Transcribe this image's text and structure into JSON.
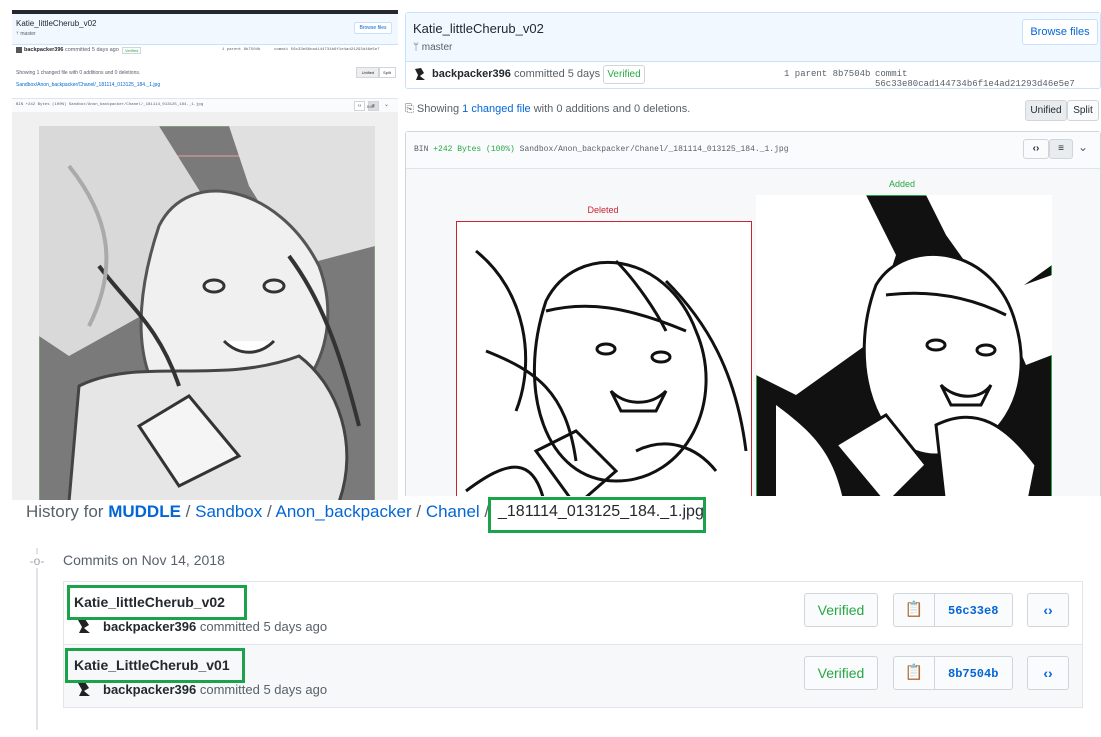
{
  "left_shot": {
    "title": "Katie_littleCherub_v02",
    "branch": "master",
    "browse_label": "Browse files",
    "author": "backpacker396",
    "committed_text": "committed 5 days ago",
    "verified_label": "Verified",
    "parent_text": "1 parent 8b7504b",
    "commit_text": "commit 56c33e88cad144734b6f1e4ad21293d46e5e7",
    "showing_text": "Showing 1 changed file with 0 additions and 0 deletions.",
    "unified_label": "Unified",
    "split_label": "Split",
    "path_text": "Sandbox/Anon_backpacker/Chanel/_181114_013125_184._1.jpg",
    "diff_header": "BIN +242 Bytes (100%) Sandbox/Anon_backpacker/Chanel/_181114_013125_184._1.jpg",
    "bin_label": "BIN"
  },
  "right_shot": {
    "title": "Katie_littleCherub_v02",
    "branch": "master",
    "browse_label": "Browse files",
    "author": "backpacker396",
    "committed_text": "committed 5 days ago",
    "verified_label": "Verified",
    "parent_text": "1 parent 8b7504b",
    "commit_text": "commit 56c33e80cad144734b6f1e4ad21293d46e5e7",
    "showing_prefix": "Showing",
    "showing_link": "1 changed file",
    "showing_suffix": "with 0 additions and 0 deletions.",
    "unified_label": "Unified",
    "split_label": "Split",
    "diff_header_bin": "BIN",
    "diff_header_size": "+242 Bytes (100%)",
    "diff_header_path": "Sandbox/Anon_backpacker/Chanel/_181114_013125_184._1.jpg",
    "deleted_label": "Deleted",
    "added_label": "Added"
  },
  "history": {
    "prefix": "History for",
    "repo": "MUDDLE",
    "sep": "/",
    "path1": "Sandbox",
    "path2": "Anon_backpacker",
    "path3": "Chanel",
    "file": "_181114_013125_184._1.jpg",
    "commits_on": "Commits on Nov 14, 2018",
    "commits": [
      {
        "title": "Katie_littleCherub_v02",
        "author": "backpacker396",
        "when": "committed 5 days ago",
        "verified": "Verified",
        "sha": "56c33e8"
      },
      {
        "title": "Katie_LittleCherub_v01",
        "author": "backpacker396",
        "when": "committed 5 days ago",
        "verified": "Verified",
        "sha": "8b7504b"
      }
    ]
  },
  "colors": {
    "link": "#0366d6",
    "verified": "#28a745",
    "highlight": "#1aa34a",
    "deleted": "#cb2431",
    "added": "#28a745"
  }
}
